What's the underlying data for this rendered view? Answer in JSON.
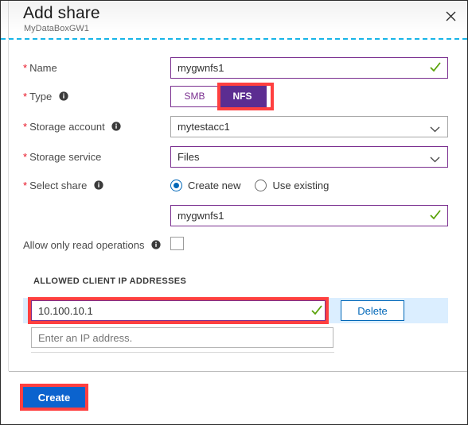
{
  "header": {
    "title": "Add share",
    "subtitle": "MyDataBoxGW1",
    "close_label": "Close"
  },
  "colors": {
    "accent_purple": "#5c2d91",
    "field_purple": "#7a2f8f",
    "highlight_red": "#ff4040",
    "primary_blue": "#0b63ce",
    "link_blue": "#0067b8",
    "row_blue": "#dbeeff",
    "required_red": "#e81123",
    "valid_green": "#5aa30a",
    "dashed_rule": "#17b5e8"
  },
  "fields": {
    "name": {
      "label": "Name",
      "required": true,
      "has_info": false,
      "value": "mygwnfs1",
      "valid": true
    },
    "type": {
      "label": "Type",
      "required": true,
      "has_info": true,
      "options": [
        "SMB",
        "NFS"
      ],
      "selected": "NFS",
      "highlighted": true
    },
    "storage_account": {
      "label": "Storage account",
      "required": true,
      "has_info": true,
      "value": "mytestacc1"
    },
    "storage_service": {
      "label": "Storage service",
      "required": true,
      "has_info": false,
      "value": "Files"
    },
    "select_share": {
      "label": "Select share",
      "required": true,
      "has_info": true,
      "options": [
        "Create new",
        "Use existing"
      ],
      "selected": "Create new",
      "share_name_value": "mygwnfs1",
      "share_name_valid": true
    },
    "read_only": {
      "label": "Allow only read operations",
      "required": false,
      "has_info": true,
      "checked": false
    }
  },
  "ip_section": {
    "heading": "ALLOWED CLIENT IP ADDRESSES",
    "rows": [
      {
        "value": "10.100.10.1",
        "valid": true,
        "highlighted": true,
        "delete_label": "Delete"
      }
    ],
    "new_row_placeholder": "Enter an IP address."
  },
  "footer": {
    "create_label": "Create",
    "create_highlighted": true
  },
  "icons": {
    "close": "close-icon",
    "info": "info-icon",
    "checkmark": "checkmark-icon",
    "chevron": "chevron-down-icon"
  }
}
